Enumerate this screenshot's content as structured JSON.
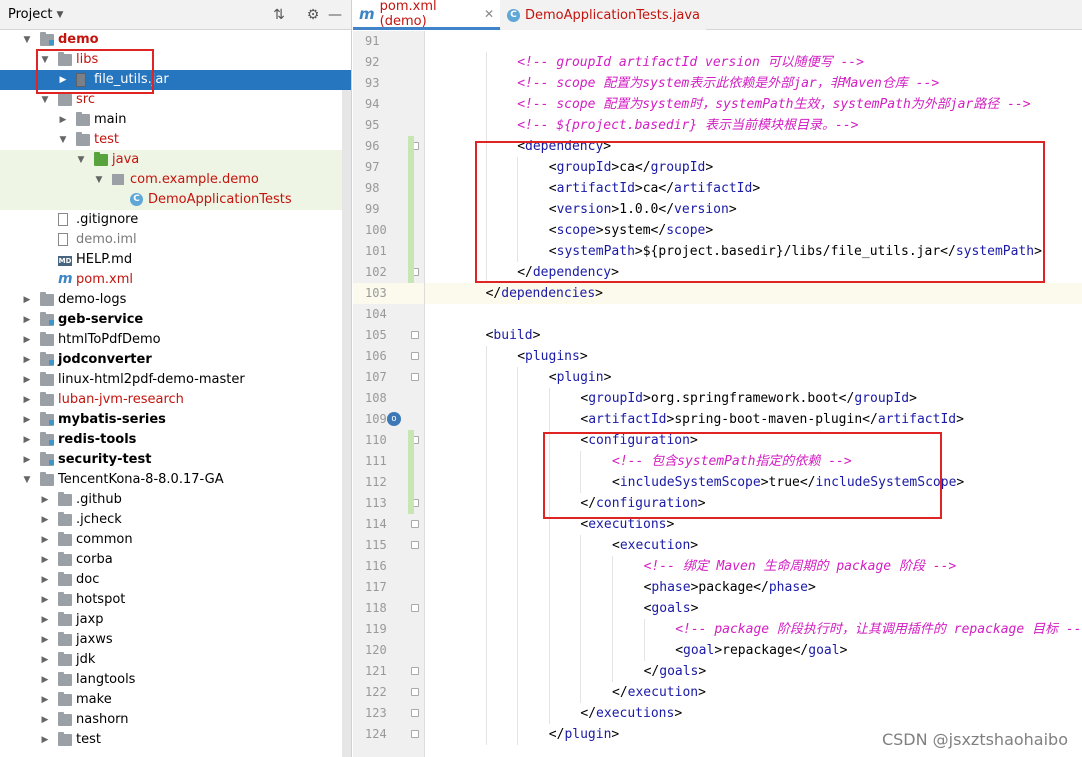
{
  "project_panel": {
    "title": "Project",
    "tree": [
      {
        "label": "demo",
        "depth": 1,
        "arrow": "open",
        "icon": "module-folder",
        "style": "red bold"
      },
      {
        "label": "libs",
        "depth": 2,
        "arrow": "open",
        "icon": "folder",
        "style": "red"
      },
      {
        "label": "file_utils.jar",
        "depth": 3,
        "arrow": "closed",
        "icon": "jar",
        "style": "selected"
      },
      {
        "label": "src",
        "depth": 2,
        "arrow": "open",
        "icon": "folder",
        "style": "red"
      },
      {
        "label": "main",
        "depth": 3,
        "arrow": "closed",
        "icon": "folder",
        "style": ""
      },
      {
        "label": "test",
        "depth": 3,
        "arrow": "open",
        "icon": "folder",
        "style": "red"
      },
      {
        "label": "java",
        "depth": 4,
        "arrow": "open",
        "icon": "green-folder",
        "style": "red green"
      },
      {
        "label": "com.example.demo",
        "depth": 5,
        "arrow": "open",
        "icon": "package",
        "style": "red green"
      },
      {
        "label": "DemoApplicationTests",
        "depth": 6,
        "arrow": "none",
        "icon": "class",
        "style": "red green"
      },
      {
        "label": ".gitignore",
        "depth": 2,
        "arrow": "none",
        "icon": "file",
        "style": ""
      },
      {
        "label": "demo.iml",
        "depth": 2,
        "arrow": "none",
        "icon": "file",
        "style": "olive"
      },
      {
        "label": "HELP.md",
        "depth": 2,
        "arrow": "none",
        "icon": "md",
        "style": ""
      },
      {
        "label": "pom.xml",
        "depth": 2,
        "arrow": "none",
        "icon": "maven",
        "style": "red"
      },
      {
        "label": "demo-logs",
        "depth": 1,
        "arrow": "closed",
        "icon": "folder",
        "style": ""
      },
      {
        "label": "geb-service",
        "depth": 1,
        "arrow": "closed",
        "icon": "module-folder",
        "style": "bold"
      },
      {
        "label": "htmlToPdfDemo",
        "depth": 1,
        "arrow": "closed",
        "icon": "folder",
        "style": ""
      },
      {
        "label": "jodconverter",
        "depth": 1,
        "arrow": "closed",
        "icon": "module-folder",
        "style": "bold"
      },
      {
        "label": "linux-html2pdf-demo-master",
        "depth": 1,
        "arrow": "closed",
        "icon": "folder",
        "style": ""
      },
      {
        "label": "luban-jvm-research",
        "depth": 1,
        "arrow": "closed",
        "icon": "folder",
        "style": "red"
      },
      {
        "label": "mybatis-series",
        "depth": 1,
        "arrow": "closed",
        "icon": "module-folder",
        "style": "bold"
      },
      {
        "label": "redis-tools",
        "depth": 1,
        "arrow": "closed",
        "icon": "module-folder",
        "style": "bold"
      },
      {
        "label": "security-test",
        "depth": 1,
        "arrow": "closed",
        "icon": "module-folder",
        "style": "bold"
      },
      {
        "label": "TencentKona-8-8.0.17-GA",
        "depth": 1,
        "arrow": "open",
        "icon": "folder",
        "style": ""
      },
      {
        "label": ".github",
        "depth": 2,
        "arrow": "closed",
        "icon": "folder",
        "style": ""
      },
      {
        "label": ".jcheck",
        "depth": 2,
        "arrow": "closed",
        "icon": "folder",
        "style": ""
      },
      {
        "label": "common",
        "depth": 2,
        "arrow": "closed",
        "icon": "folder",
        "style": ""
      },
      {
        "label": "corba",
        "depth": 2,
        "arrow": "closed",
        "icon": "folder",
        "style": ""
      },
      {
        "label": "doc",
        "depth": 2,
        "arrow": "closed",
        "icon": "folder",
        "style": ""
      },
      {
        "label": "hotspot",
        "depth": 2,
        "arrow": "closed",
        "icon": "folder",
        "style": ""
      },
      {
        "label": "jaxp",
        "depth": 2,
        "arrow": "closed",
        "icon": "folder",
        "style": ""
      },
      {
        "label": "jaxws",
        "depth": 2,
        "arrow": "closed",
        "icon": "folder",
        "style": ""
      },
      {
        "label": "jdk",
        "depth": 2,
        "arrow": "closed",
        "icon": "folder",
        "style": ""
      },
      {
        "label": "langtools",
        "depth": 2,
        "arrow": "closed",
        "icon": "folder",
        "style": ""
      },
      {
        "label": "make",
        "depth": 2,
        "arrow": "closed",
        "icon": "folder",
        "style": ""
      },
      {
        "label": "nashorn",
        "depth": 2,
        "arrow": "closed",
        "icon": "folder",
        "style": ""
      },
      {
        "label": "test",
        "depth": 2,
        "arrow": "closed",
        "icon": "folder",
        "style": ""
      }
    ]
  },
  "tabs": [
    {
      "label": "pom.xml (demo)",
      "icon": "maven",
      "active": true
    },
    {
      "label": "DemoApplicationTests.java",
      "icon": "class",
      "active": false
    }
  ],
  "editor": {
    "lines": [
      {
        "n": "91",
        "indent": 0,
        "parts": []
      },
      {
        "n": "92",
        "indent": 2,
        "parts": [
          [
            "cmt",
            "<!-- groupId artifactId version 可以随便写 -->"
          ]
        ]
      },
      {
        "n": "93",
        "indent": 2,
        "parts": [
          [
            "cmt",
            "<!-- scope 配置为system表示此依赖是外部jar，非Maven仓库 -->"
          ]
        ]
      },
      {
        "n": "94",
        "indent": 2,
        "parts": [
          [
            "cmt",
            "<!-- scope 配置为system时，systemPath生效，systemPath为外部jar路径 -->"
          ]
        ]
      },
      {
        "n": "95",
        "indent": 2,
        "parts": [
          [
            "cmt",
            "<!-- ${project.basedir} 表示当前模块根目录。-->"
          ]
        ]
      },
      {
        "n": "96",
        "indent": 2,
        "parts": [
          [
            "tx",
            "<"
          ],
          [
            "tg",
            "dependency"
          ],
          [
            "tx",
            ">"
          ]
        ]
      },
      {
        "n": "97",
        "indent": 3,
        "parts": [
          [
            "tx",
            "<"
          ],
          [
            "tg",
            "groupId"
          ],
          [
            "tx",
            ">ca</"
          ],
          [
            "tg",
            "groupId"
          ],
          [
            "tx",
            ">"
          ]
        ]
      },
      {
        "n": "98",
        "indent": 3,
        "parts": [
          [
            "tx",
            "<"
          ],
          [
            "tg",
            "artifactId"
          ],
          [
            "tx",
            ">ca</"
          ],
          [
            "tg",
            "artifactId"
          ],
          [
            "tx",
            ">"
          ]
        ]
      },
      {
        "n": "99",
        "indent": 3,
        "parts": [
          [
            "tx",
            "<"
          ],
          [
            "tg",
            "version"
          ],
          [
            "tx",
            ">1.0.0</"
          ],
          [
            "tg",
            "version"
          ],
          [
            "tx",
            ">"
          ]
        ]
      },
      {
        "n": "100",
        "indent": 3,
        "parts": [
          [
            "tx",
            "<"
          ],
          [
            "tg",
            "scope"
          ],
          [
            "tx",
            ">system</"
          ],
          [
            "tg",
            "scope"
          ],
          [
            "tx",
            ">"
          ]
        ]
      },
      {
        "n": "101",
        "indent": 3,
        "parts": [
          [
            "tx",
            "<"
          ],
          [
            "tg",
            "systemPath"
          ],
          [
            "tx",
            ">${project.basedir}/libs/file_utils.jar</"
          ],
          [
            "tg",
            "systemPath"
          ],
          [
            "tx",
            ">"
          ]
        ]
      },
      {
        "n": "102",
        "indent": 2,
        "parts": [
          [
            "tx",
            "</"
          ],
          [
            "tg",
            "dependency"
          ],
          [
            "tx",
            ">"
          ]
        ]
      },
      {
        "n": "103",
        "indent": 1,
        "parts": [
          [
            "tx",
            "</"
          ],
          [
            "tg",
            "dependencies"
          ],
          [
            "tx",
            ">"
          ]
        ],
        "highlight": true
      },
      {
        "n": "104",
        "indent": 0,
        "parts": []
      },
      {
        "n": "105",
        "indent": 1,
        "parts": [
          [
            "tx",
            "<"
          ],
          [
            "tg",
            "build"
          ],
          [
            "tx",
            ">"
          ]
        ]
      },
      {
        "n": "106",
        "indent": 2,
        "parts": [
          [
            "tx",
            "<"
          ],
          [
            "tg",
            "plugins"
          ],
          [
            "tx",
            ">"
          ]
        ]
      },
      {
        "n": "107",
        "indent": 3,
        "parts": [
          [
            "tx",
            "<"
          ],
          [
            "tg",
            "plugin"
          ],
          [
            "tx",
            ">"
          ]
        ]
      },
      {
        "n": "108",
        "indent": 4,
        "parts": [
          [
            "tx",
            "<"
          ],
          [
            "tg",
            "groupId"
          ],
          [
            "tx",
            ">org.springframework.boot</"
          ],
          [
            "tg",
            "groupId"
          ],
          [
            "tx",
            ">"
          ]
        ]
      },
      {
        "n": "109",
        "indent": 4,
        "parts": [
          [
            "tx",
            "<"
          ],
          [
            "tg",
            "artifactId"
          ],
          [
            "tx",
            ">spring-boot-maven-plugin</"
          ],
          [
            "tg",
            "artifactId"
          ],
          [
            "tx",
            ">"
          ]
        ],
        "run": true
      },
      {
        "n": "110",
        "indent": 4,
        "parts": [
          [
            "tx",
            "<"
          ],
          [
            "tg",
            "configuration"
          ],
          [
            "tx",
            ">"
          ]
        ]
      },
      {
        "n": "111",
        "indent": 5,
        "parts": [
          [
            "cmt",
            "<!-- 包含systemPath指定的依赖 -->"
          ]
        ]
      },
      {
        "n": "112",
        "indent": 5,
        "parts": [
          [
            "tx",
            "<"
          ],
          [
            "tg",
            "includeSystemScope"
          ],
          [
            "tx",
            ">true</"
          ],
          [
            "tg",
            "includeSystemScope"
          ],
          [
            "tx",
            ">"
          ]
        ]
      },
      {
        "n": "113",
        "indent": 4,
        "parts": [
          [
            "tx",
            "</"
          ],
          [
            "tg",
            "configuration"
          ],
          [
            "tx",
            ">"
          ]
        ]
      },
      {
        "n": "114",
        "indent": 4,
        "parts": [
          [
            "tx",
            "<"
          ],
          [
            "tg",
            "executions"
          ],
          [
            "tx",
            ">"
          ]
        ]
      },
      {
        "n": "115",
        "indent": 5,
        "parts": [
          [
            "tx",
            "<"
          ],
          [
            "tg",
            "execution"
          ],
          [
            "tx",
            ">"
          ]
        ]
      },
      {
        "n": "116",
        "indent": 6,
        "parts": [
          [
            "cmt",
            "<!-- 绑定 Maven 生命周期的 package 阶段 -->"
          ]
        ]
      },
      {
        "n": "117",
        "indent": 6,
        "parts": [
          [
            "tx",
            "<"
          ],
          [
            "tg",
            "phase"
          ],
          [
            "tx",
            ">package</"
          ],
          [
            "tg",
            "phase"
          ],
          [
            "tx",
            ">"
          ]
        ]
      },
      {
        "n": "118",
        "indent": 6,
        "parts": [
          [
            "tx",
            "<"
          ],
          [
            "tg",
            "goals"
          ],
          [
            "tx",
            ">"
          ]
        ]
      },
      {
        "n": "119",
        "indent": 7,
        "parts": [
          [
            "cmt",
            "<!-- package 阶段执行时，让其调用插件的 repackage 目标 -->"
          ]
        ]
      },
      {
        "n": "120",
        "indent": 7,
        "parts": [
          [
            "tx",
            "<"
          ],
          [
            "tg",
            "goal"
          ],
          [
            "tx",
            ">repackage</"
          ],
          [
            "tg",
            "goal"
          ],
          [
            "tx",
            ">"
          ]
        ]
      },
      {
        "n": "121",
        "indent": 6,
        "parts": [
          [
            "tx",
            "</"
          ],
          [
            "tg",
            "goals"
          ],
          [
            "tx",
            ">"
          ]
        ]
      },
      {
        "n": "122",
        "indent": 5,
        "parts": [
          [
            "tx",
            "</"
          ],
          [
            "tg",
            "execution"
          ],
          [
            "tx",
            ">"
          ]
        ]
      },
      {
        "n": "123",
        "indent": 4,
        "parts": [
          [
            "tx",
            "</"
          ],
          [
            "tg",
            "executions"
          ],
          [
            "tx",
            ">"
          ]
        ]
      },
      {
        "n": "124",
        "indent": 3,
        "parts": [
          [
            "tx",
            "</"
          ],
          [
            "tg",
            "plugin"
          ],
          [
            "tx",
            ">"
          ]
        ]
      }
    ]
  },
  "watermark": "CSDN @jsxztshaohaibo",
  "colors": {
    "selection": "#2675bf",
    "annotation_box": "#e02424",
    "comment": "#d21ec2",
    "tag": "#1a1aa6"
  }
}
